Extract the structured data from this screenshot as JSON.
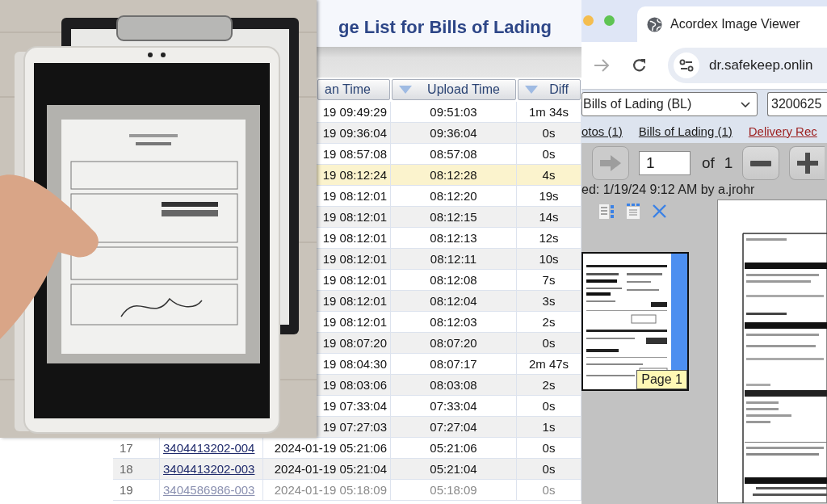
{
  "image_list": {
    "title": "ge List for Bills of Lading",
    "columns": [
      {
        "label": "an Time",
        "sort_indicator": false
      },
      {
        "label": "Upload Time",
        "sort_indicator": true
      },
      {
        "label": "Diff",
        "sort_indicator": true
      }
    ],
    "rows": [
      {
        "scan_time": "19 09:49:29",
        "upload_time": "09:51:03",
        "diff": "1m 34s",
        "selected": false
      },
      {
        "scan_time": "19 09:36:04",
        "upload_time": "09:36:04",
        "diff": "0s",
        "selected": false
      },
      {
        "scan_time": "19 08:57:08",
        "upload_time": "08:57:08",
        "diff": "0s",
        "selected": false
      },
      {
        "scan_time": "19 08:12:24",
        "upload_time": "08:12:28",
        "diff": "4s",
        "selected": true
      },
      {
        "scan_time": "19 08:12:01",
        "upload_time": "08:12:20",
        "diff": "19s",
        "selected": false
      },
      {
        "scan_time": "19 08:12:01",
        "upload_time": "08:12:15",
        "diff": "14s",
        "selected": false
      },
      {
        "scan_time": "19 08:12:01",
        "upload_time": "08:12:13",
        "diff": "12s",
        "selected": false
      },
      {
        "scan_time": "19 08:12:01",
        "upload_time": "08:12:11",
        "diff": "10s",
        "selected": false
      },
      {
        "scan_time": "19 08:12:01",
        "upload_time": "08:12:08",
        "diff": "7s",
        "selected": false
      },
      {
        "scan_time": "19 08:12:01",
        "upload_time": "08:12:04",
        "diff": "3s",
        "selected": false
      },
      {
        "scan_time": "19 08:12:01",
        "upload_time": "08:12:03",
        "diff": "2s",
        "selected": false
      },
      {
        "scan_time": "19 08:07:20",
        "upload_time": "08:07:20",
        "diff": "0s",
        "selected": false
      },
      {
        "scan_time": "19 08:04:30",
        "upload_time": "08:07:17",
        "diff": "2m 47s",
        "selected": false
      },
      {
        "scan_time": "19 08:03:06",
        "upload_time": "08:03:08",
        "diff": "2s",
        "selected": false
      },
      {
        "scan_time": "19 07:33:04",
        "upload_time": "07:33:04",
        "diff": "0s",
        "selected": false
      },
      {
        "scan_time": "19 07:27:03",
        "upload_time": "07:27:04",
        "diff": "1s",
        "selected": false
      },
      {
        "number": "17",
        "image_id": "3404413202-004",
        "scan_time": "2024-01-19 05:21:06",
        "upload_time": "05:21:06",
        "diff": "0s",
        "selected": false
      },
      {
        "number": "18",
        "image_id": "3404413202-003",
        "scan_time": "2024-01-19 05:21:04",
        "upload_time": "05:21:04",
        "diff": "0s",
        "selected": false
      },
      {
        "number": "19",
        "image_id": "3404586986-003",
        "scan_time": "2024-01-19 05:18:09",
        "upload_time": "05:18:09",
        "diff": "0s",
        "selected": false
      }
    ]
  },
  "browser": {
    "tabs": [
      {
        "title": "Acordex Image Viewer",
        "selected": true
      }
    ],
    "nav_buttons": [
      {
        "kind": "forward",
        "disabled": true
      },
      {
        "kind": "reload",
        "disabled": false
      }
    ],
    "address": "dr.safekeep.onlin",
    "viewer": {
      "document_type": "Bills of Lading (BL)",
      "search_value": "3200625",
      "links": [
        {
          "label": "otos (1)",
          "color": "#1a1a1a"
        },
        {
          "label": "Bills of Lading (1)",
          "color": "#1a1a1a"
        },
        {
          "label": "Delivery Rec",
          "color": "#9b1c1c"
        }
      ],
      "pager": {
        "nav_buttons": [
          {
            "kind": "next",
            "disabled": true
          }
        ],
        "page": "1",
        "of_label": "of",
        "total": "1",
        "zoom_buttons": [
          {
            "kind": "zoom_out",
            "disabled": false
          },
          {
            "kind": "zoom_in",
            "disabled": false
          }
        ]
      },
      "scan_info": "ed: 1/19/24 9:12 AM by a.jrohr",
      "thumbnails": [
        {
          "label": "Page 1",
          "selected": true
        }
      ]
    }
  }
}
